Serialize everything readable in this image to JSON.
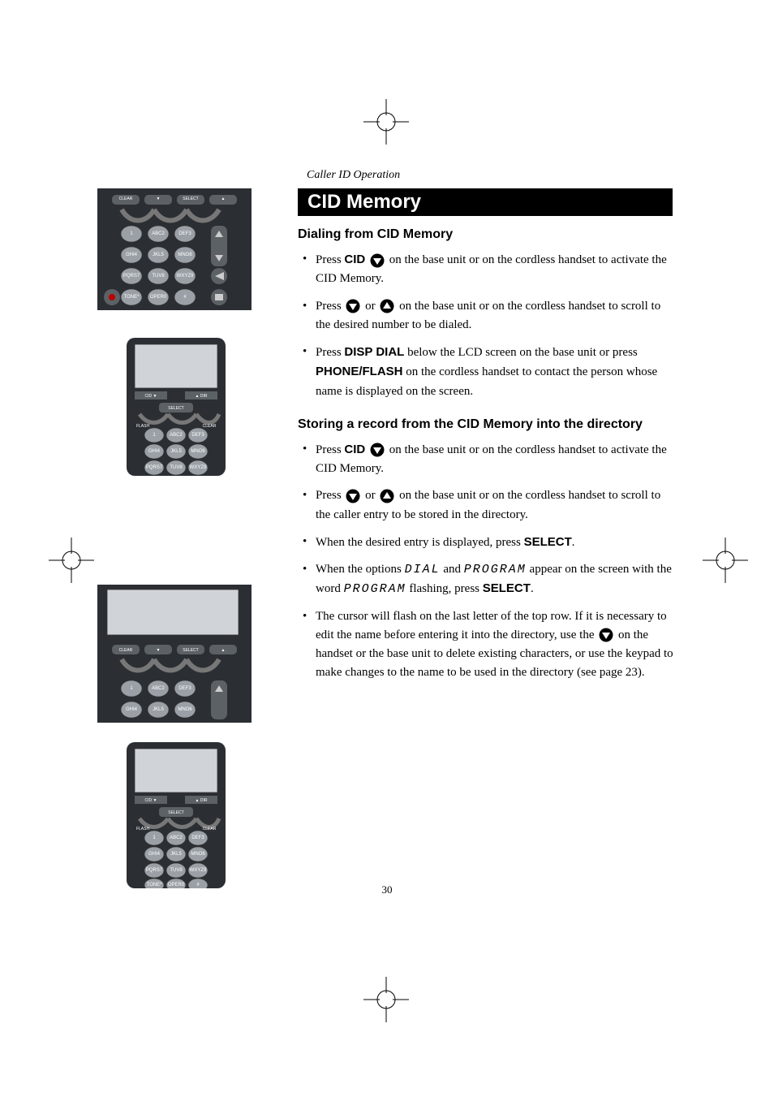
{
  "header": {
    "section": "Caller ID Operation"
  },
  "title": "CID Memory",
  "section1": {
    "heading": "Dialing from CID Memory",
    "items": [
      {
        "pre": "Press ",
        "b1": "CID",
        "post1": " ",
        "icon1": "down",
        "post": " on the base unit or on the cordless handset to activate the CID Memory."
      },
      {
        "pre": "Press ",
        "icon1": "down",
        "mid": " or ",
        "icon2": "up",
        "post": " on the base unit or on the cordless handset to scroll to the desired number to be dialed."
      },
      {
        "pre": "Press ",
        "b1": "DISP DIAL",
        "mid1": " below the LCD screen on the base unit or press ",
        "b2": "PHONE/FLASH",
        "post": " on the cordless handset to contact the person whose name is displayed on the screen."
      }
    ]
  },
  "section2": {
    "heading": "Storing a record from the CID Memory into the directory",
    "items": [
      {
        "pre": "Press ",
        "b1": "CID",
        "post1": " ",
        "icon1": "down",
        "post": " on the base unit or on the cordless handset to activate the CID Memory."
      },
      {
        "pre": "Press ",
        "icon1": "down",
        "mid": " or ",
        "icon2": "up",
        "post": " on the base unit or on the cordless handset to scroll to the caller entry to be stored in the directory."
      },
      {
        "pre": "When the desired entry is displayed, press ",
        "b1": "SELECT",
        "post": "."
      },
      {
        "pre": "When the options ",
        "lcd1": "DIAL",
        "mid": " and ",
        "lcd2": "PROGRAM",
        "mid2": " appear on the screen with the word  ",
        "lcd3": "PROGRAM",
        "mid3": " flashing, press ",
        "b1": "SELECT",
        "post": "."
      },
      {
        "pre": "The cursor will flash on the last letter of the top row. If it is necessary to edit the name before enter­ing it into the directory, use the ",
        "icon1": "down",
        "post": " on the handset or the base unit to delete existing characters, or use the keypad to make changes to the name to be used in the directory (see page 23)."
      }
    ]
  },
  "page_number": "30",
  "icons": {
    "down": "▼",
    "up": "▲"
  }
}
